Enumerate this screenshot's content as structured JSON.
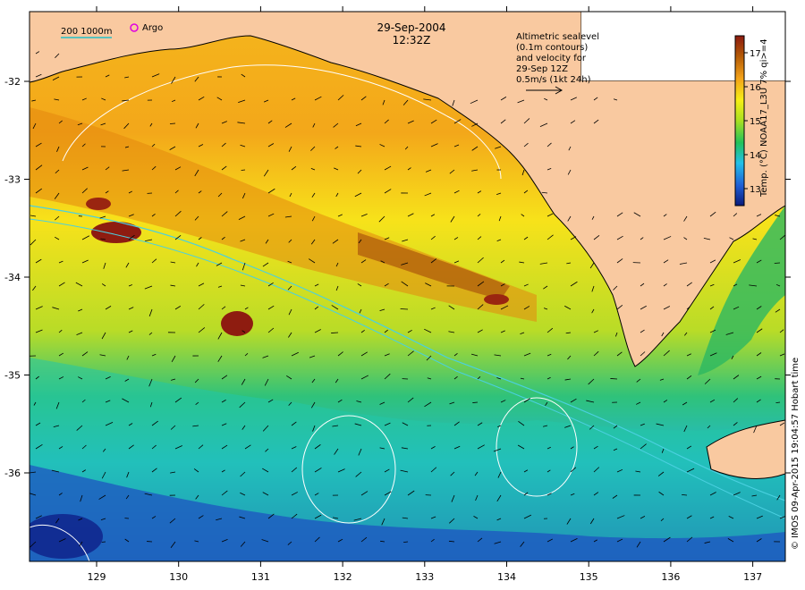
{
  "header": {
    "date": "29-Sep-2004",
    "time": "12:32Z"
  },
  "legend": {
    "bathymetry_label": "200  1000m",
    "argo_label": "Argo"
  },
  "annotation": {
    "lines": [
      "Altimetric sealevel",
      "(0.1m contours)",
      "and velocity for",
      "29-Sep 12Z",
      "0.5m/s (1kt 24h)"
    ]
  },
  "colorbar": {
    "label": "Temp. (°C) NOAA17_L3U 7% qi>=4",
    "ticks": [
      "13",
      "14",
      "15",
      "16",
      "17"
    ],
    "range": [
      12.5,
      17.5
    ],
    "colors": [
      "#0b1a7a",
      "#1f5fd6",
      "#23c0e8",
      "#22c25a",
      "#a9e021",
      "#f6ef16",
      "#f3a219",
      "#b45a07",
      "#8b1a10"
    ]
  },
  "axes": {
    "x_ticks": [
      "129",
      "130",
      "131",
      "132",
      "133",
      "134",
      "135",
      "136",
      "137"
    ],
    "y_ticks": [
      "-32",
      "-33",
      "-34",
      "-35",
      "-36"
    ]
  },
  "credit": "© IMOS 09-Apr-2015 19:04:57 Hobart time",
  "colors": {
    "land": "#f9c9a0",
    "warm": "#f3b21a",
    "cool": "#21b7d8",
    "deep": "#1d4fc6"
  }
}
